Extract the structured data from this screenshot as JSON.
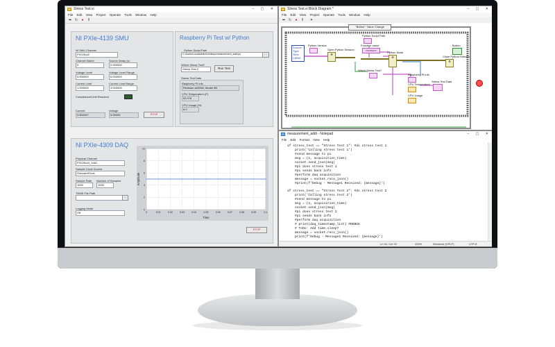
{
  "front_panel": {
    "title": "Stress Test.vi",
    "menu": [
      "File",
      "Edit",
      "View",
      "Project",
      "Operate",
      "Tools",
      "Window",
      "Help"
    ],
    "smu": {
      "title": "NI PXIe-4139 SMU",
      "channel_label": "NI SMU Channel",
      "channel_value": "PXI1Slot2",
      "channel_name_label": "Channel Name",
      "channel_name_value": "0",
      "source_delay_label": "Source Delay (s)",
      "source_delay_value": "0.000000",
      "voltage_level_label": "Voltage Level",
      "voltage_level_value": "5.000000",
      "voltage_range_label": "Voltage Level Range",
      "voltage_range_value": "6.000000",
      "current_limit_label": "Current Limit",
      "current_limit_value": "1.000000",
      "current_range_label": "Current Limit Range",
      "current_range_value": "3.000000",
      "compliance_label": "Compliance/Limit Reached",
      "current_label": "Current",
      "current_value": "0.502257",
      "voltage_label": "Voltage",
      "voltage_value": "5.00005",
      "stop_label": "STOP"
    },
    "rpi": {
      "title": "Raspberry Pi Test w/ Python",
      "script_path_label": "Python Script Path",
      "script_path_value": "C:\\Users\\Localadmin\\Desktop\\measurement_addi.py",
      "which_test_label": "Which Stress Test?",
      "which_test_value": "Stress Test 2",
      "run_test_label": "Run Test",
      "data_header": "Stress Test Data",
      "pi_info_label": "Raspberry Pi Info",
      "pi_info_value": "Revision a02082, Model 3B",
      "cpu_temp_label": "CPU Temperature (F)",
      "cpu_temp_value": "52.078",
      "cpu_usage_label": "CPU Usage (%)",
      "cpu_usage_value": "6.0"
    },
    "daq": {
      "title": "NI PXIe-4309 DAQ",
      "physical_channel_label": "Physical Channel",
      "physical_channel_value": "PXI1Slot4_1/ai0",
      "clock_source_label": "Sample Clock Source",
      "clock_source_value": "OnboardClock",
      "sample_rate_label": "Sample Rate",
      "sample_rate_value": "1000",
      "num_samples_label": "Number of Samples",
      "num_samples_value": "1000",
      "tdms_label": "TDMS File Path",
      "logging_mode_label": "Logging Mode",
      "logging_mode_value": "Off",
      "stop_label": "STOP"
    }
  },
  "block_diagram": {
    "title": "Stress Test.vi Block Diagram *",
    "menu": [
      "File",
      "Edit",
      "View",
      "Project",
      "Operate",
      "Tools",
      "Window",
      "Help"
    ],
    "case_selector": "\"Button\": Value Change",
    "cluster_items": [
      "Source",
      "Type",
      "Time",
      "CtlRef"
    ],
    "labels": {
      "python_version": "Python Version",
      "open_python_session": "Open Python Session",
      "script_path": "Python Script Path",
      "function_name": "Function name",
      "function_value": "measure",
      "python_node": "Python Node",
      "which_test": "Which Stress Test?",
      "pi_info": "Raspberry Pi Info",
      "cpu_temperature": "CPU Temperature",
      "cpu_usage": "CPU Usage",
      "stress_data": "Stress Test Data",
      "button": "Button",
      "close_python_session": "Close Python Session"
    }
  },
  "notepad": {
    "title": "measurement_addi - Notepad",
    "menu": [
      "File",
      "Edit",
      "Format",
      "View",
      "Help"
    ],
    "lines": [
      "if stress_test == \"Stress Test 1\": #do stress test 1",
      "    print('Calling stress test 1')",
      "    #send message to pi",
      "    msg = (1, acquisition_time)",
      "    socket.send_json(msg)",
      "    #pi does stress test 1",
      "    #pi sends back info",
      "    #perform daq acquisition",
      "    message = socket.recv_json()",
      "    #print(f'Debug - Message1 Received: {message}')",
      "",
      "if stress_test == \"Stress Test 2\": #do stress test 2",
      "    print('Calling stress test 2')",
      "    #send message to pi",
      "    msg = (2, acquisition_time)",
      "    socket.send_json(msg)",
      "    #pi does stress test 2",
      "    #pi sends back info",
      "    #perform daq acquisition",
      "    # print(daq_timestamp_list) #DEBUG",
      "    # ToDo: Add time.sleep?",
      "    message = socket.recv_json()",
      "    print(f'Debug - Message2 Received: {message}')"
    ],
    "status": {
      "position": "Ln 54, Col 33",
      "zoom": "100%",
      "line_ending": "Windows (CRLF)",
      "encoding": "UTF-8"
    }
  },
  "chart_data": {
    "type": "line",
    "x": [
      0,
      0.01,
      0.02,
      0.03,
      0.04,
      0.05,
      0.06,
      0.07,
      0.08,
      0.09,
      0.1
    ],
    "series": [
      {
        "values": [
          5,
          5,
          5,
          5,
          5,
          5,
          5,
          5,
          5,
          5,
          5
        ]
      }
    ],
    "xticks": [
      "0",
      "0.01",
      "0.02",
      "0.03",
      "0.04",
      "0.05",
      "0.06",
      "0.07",
      "0.08",
      "0.09",
      "0.1"
    ],
    "yticks": [
      "10",
      "8",
      "6",
      "4",
      "2",
      "0"
    ],
    "xlabel": "Time",
    "ylabel": "Amplitude",
    "xlim": [
      0,
      0.1
    ],
    "ylim": [
      0,
      10
    ],
    "grid": true,
    "colors": {
      "trace": "#3a6fd8",
      "plot_bg": "#ffffff",
      "frame": "#cfd1d6"
    }
  }
}
